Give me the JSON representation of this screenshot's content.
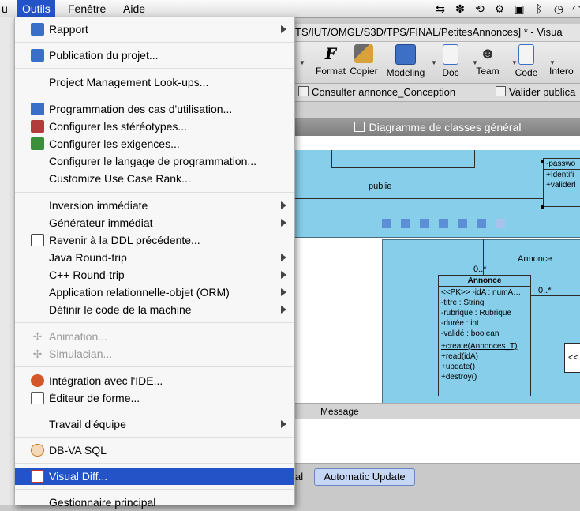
{
  "menubar": {
    "partial_left": "u",
    "items": [
      "Outils",
      "Fenêtre",
      "Aide"
    ],
    "active": "Outils"
  },
  "window": {
    "title": "TS/IUT/OMGL/S3D/TPS/FINAL/PetitesAnnonces] * - Visua"
  },
  "toolbar": {
    "buttons": [
      "Format",
      "Copier",
      "Modeling",
      "Doc",
      "Team",
      "Code",
      "Intero"
    ]
  },
  "tabs": [
    "Consulter annonce_Conception",
    "Valider publica"
  ],
  "diagram": {
    "title": "Diagramme de classes général",
    "assoc_label": "publie",
    "class_name": "Annonce",
    "attributes": [
      "<<PK>> -idA : numA…",
      "-titre : String",
      "-rubrique : Rubrique",
      "-durée : int",
      "-validé : boolean"
    ],
    "operations": [
      "+create(Annonces_T)",
      "+read(idA)",
      "+update()",
      "+destroy()"
    ],
    "mult_top": "0..*",
    "mult_right": "0..*",
    "right_label": "Annonce",
    "partial_attrs": [
      "-passwo",
      "+Identifi",
      "+validerl"
    ],
    "partial_stereo": "<<"
  },
  "message_header": "Message",
  "status_tab_partial": "al",
  "status_tab": "Automatic Update",
  "menu": {
    "items": [
      {
        "label": "Rapport",
        "submenu": true,
        "icon": "report-icon",
        "color": "#3a6fc9"
      },
      {
        "label": "Publication du projet...",
        "submenu": false,
        "icon": "publish-icon",
        "color": "#3a6fc9"
      },
      {
        "label": "Project Management Look-ups...",
        "submenu": false
      },
      {
        "label": "Programmation des cas d'utilisation...",
        "submenu": false,
        "icon": "usecase-icon",
        "color": "#3a6fc9"
      },
      {
        "label": "Configurer les stéréotypes...",
        "submenu": false,
        "icon": "stereotype-icon",
        "color": "#b23c3c"
      },
      {
        "label": "Configurer les exigences...",
        "submenu": false,
        "icon": "requirement-icon",
        "color": "#3b8f3b"
      },
      {
        "label": "Configurer le langage de programmation...",
        "submenu": false
      },
      {
        "label": "Customize Use Case Rank...",
        "submenu": false
      },
      {
        "label": "Inversion immédiate",
        "submenu": true
      },
      {
        "label": "Générateur immédiat",
        "submenu": true
      },
      {
        "label": "Revenir à la DDL précédente...",
        "submenu": false,
        "icon": "ddl-icon",
        "color": "#444444"
      },
      {
        "label": "Java Round-trip",
        "submenu": true
      },
      {
        "label": "C++ Round-trip",
        "submenu": true
      },
      {
        "label": "Application relationnelle-objet (ORM)",
        "submenu": true
      },
      {
        "label": "Définir le code de la machine",
        "submenu": true
      },
      {
        "label": "Animation...",
        "submenu": false,
        "disabled": true,
        "icon": "animation-icon",
        "color": "#aaaaaa"
      },
      {
        "label": "Simulacian...",
        "submenu": false,
        "disabled": true,
        "icon": "simulation-icon",
        "color": "#aaaaaa"
      },
      {
        "label": "Intégration avec l'IDE...",
        "submenu": false,
        "icon": "ide-icon",
        "color": "#d4572a"
      },
      {
        "label": "Éditeur de forme...",
        "submenu": false,
        "icon": "shape-editor-icon",
        "color": "#555555"
      },
      {
        "label": "Travail d'équipe",
        "submenu": true
      },
      {
        "label": "DB-VA SQL",
        "submenu": false,
        "icon": "dbva-icon",
        "color": "#c8752a"
      },
      {
        "label": "Visual Diff...",
        "submenu": false,
        "selected": true,
        "icon": "visual-diff-icon",
        "color": "#c33"
      },
      {
        "label": "Gestionnaire principal",
        "submenu": false
      }
    ]
  },
  "colors": {
    "accent": "#2453c7",
    "canvas_blue": "#87ceeb"
  }
}
